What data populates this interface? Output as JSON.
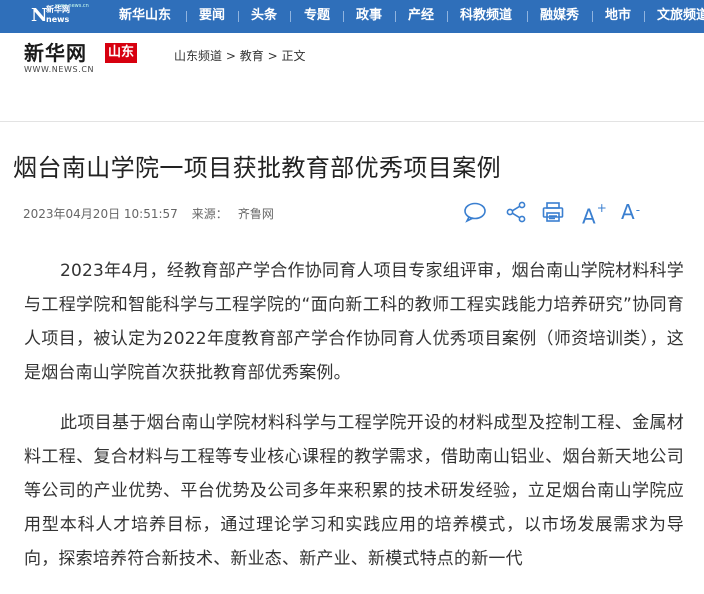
{
  "topnav": {
    "logo": {
      "main": "N",
      "line1": "新华网",
      "line2": "news",
      "tiny": "www.news.cn"
    },
    "items": [
      "新华山东",
      "要闻",
      "头条",
      "专题",
      "政事",
      "产经",
      "科教频道",
      "融媒秀",
      "地市",
      "文旅频道"
    ],
    "bg_color": "#2f6fba"
  },
  "brand": {
    "logo_text": "新华网",
    "region": "山东",
    "url": "WWW.NEWS.CN",
    "breadcrumb": [
      "山东频道",
      "教育",
      "正文"
    ],
    "breadcrumb_sep": ">",
    "accent_color": "#d7000f"
  },
  "article": {
    "title": "烟台南山学院一项目获批教育部优秀项目案例",
    "date": "2023年04月20日 10:51:57",
    "source_label": "来源：",
    "source": "齐鲁网",
    "tools": [
      {
        "icon": "comment-icon"
      },
      {
        "icon": "share-icon"
      },
      {
        "icon": "print-icon"
      },
      {
        "icon": "font-increase-icon",
        "label": "A",
        "mark": "+"
      },
      {
        "icon": "font-decrease-icon",
        "label": "A",
        "mark": "-"
      }
    ],
    "tool_color": "#3a7fd0",
    "paragraphs": [
      "2023年4月，经教育部产学合作协同育人项目专家组评审，烟台南山学院材料科学与工程学院和智能科学与工程学院的“面向新工科的教师工程实践能力培养研究”协同育人项目，被认定为2022年度教育部产学合作协同育人优秀项目案例（师资培训类），这是烟台南山学院首次获批教育部优秀案例。",
      "此项目基于烟台南山学院材料科学与工程学院开设的材料成型及控制工程、金属材料工程、复合材料与工程等专业核心课程的教学需求，借助南山铝业、烟台新天地公司等公司的产业优势、平台优势及公司多年来积累的技术研发经验，立足烟台南山学院应用型本科人才培养目标，通过理论学习和实践应用的培养模式，以市场发展需求为导向，探索培养符合新技术、新业态、新产业、新模式特点的新一代"
    ]
  }
}
